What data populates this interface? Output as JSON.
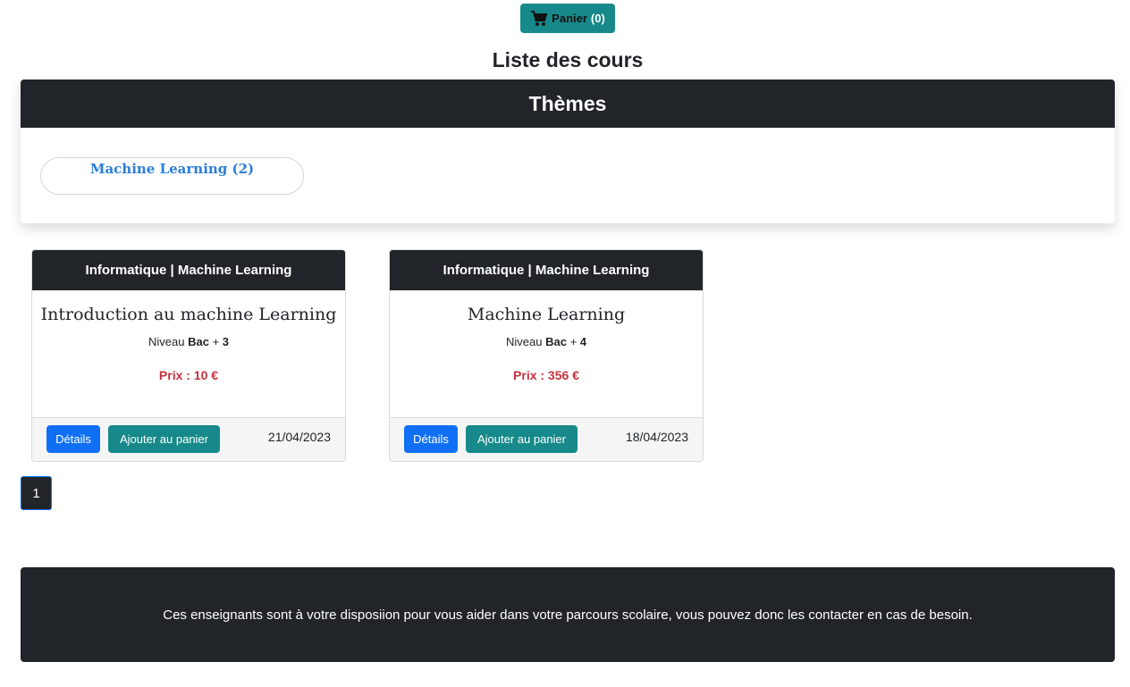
{
  "cart": {
    "label": "Panier",
    "count": "(0)"
  },
  "page_title": "Liste des cours",
  "themes": {
    "header": "Thèmes",
    "items": [
      {
        "label": "Machine Learning (2)"
      }
    ]
  },
  "courses": [
    {
      "category": "Informatique | Machine Learning",
      "title": "Introduction au machine Learning",
      "level_prefix": "Niveau",
      "level_main": "Bac",
      "level_plus": "+",
      "level_num": "3",
      "price": "Prix : 10 €",
      "details_label": "Détails",
      "add_label": "Ajouter au panier",
      "date": "21/04/2023"
    },
    {
      "category": "Informatique | Machine Learning",
      "title": "Machine Learning",
      "level_prefix": "Niveau",
      "level_main": "Bac",
      "level_plus": "+",
      "level_num": "4",
      "price": "Prix : 356 €",
      "details_label": "Détails",
      "add_label": "Ajouter au panier",
      "date": "18/04/2023"
    }
  ],
  "pagination": {
    "current": "1"
  },
  "footer": {
    "text": "Ces enseignants sont à votre disposiion pour vous aider dans votre parcours scolaire, vous pouvez donc les contacter en cas de besoin."
  },
  "colors": {
    "dark": "#212529",
    "teal": "#17898a",
    "primary": "#1070f5",
    "price_red": "#c9303d",
    "theme_link": "#2a7dd8"
  }
}
